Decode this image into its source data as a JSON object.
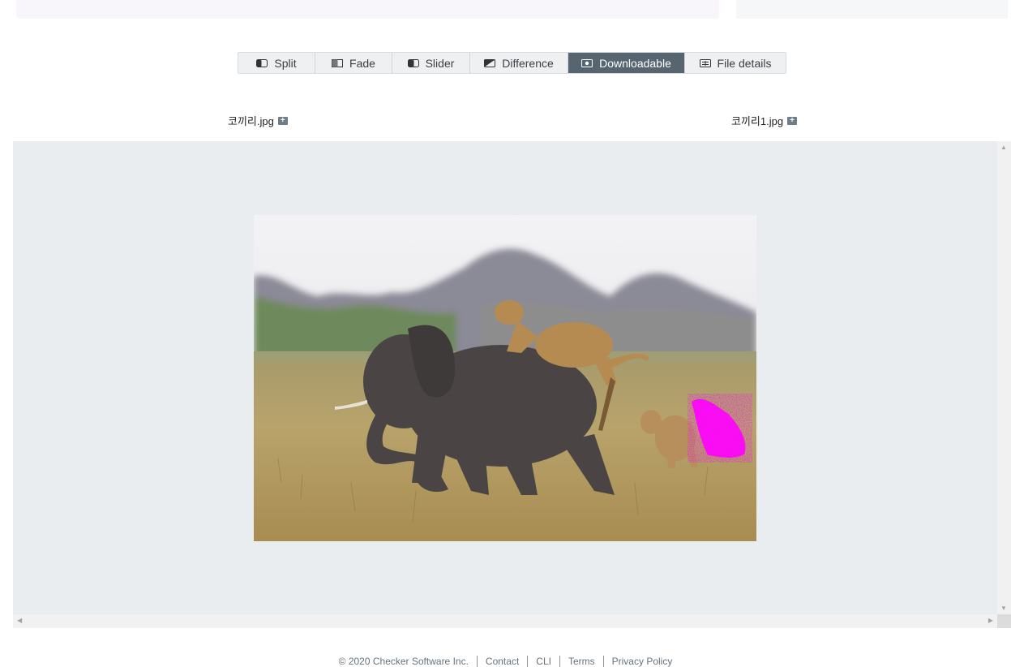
{
  "toolbar": {
    "tabs": [
      {
        "label": "Split",
        "icon": "split-icon"
      },
      {
        "label": "Fade",
        "icon": "fade-icon"
      },
      {
        "label": "Slider",
        "icon": "slider-icon"
      },
      {
        "label": "Difference",
        "icon": "difference-icon"
      },
      {
        "label": "Downloadable",
        "icon": "downloadable-icon",
        "active": true
      },
      {
        "label": "File details",
        "icon": "file-details-icon"
      }
    ]
  },
  "files": {
    "left": {
      "name": "코끼리.jpg"
    },
    "right": {
      "name": "코끼리1.jpg"
    }
  },
  "viewer": {
    "image": "elephant-with-lions-photo",
    "diff_highlight_color": "#ff00ff",
    "background_color": "#eaedf0"
  },
  "colors": {
    "active_tab": "#566570",
    "tab_bg": "#eef0f2"
  },
  "footer": {
    "copyright": "© 2020 Checker Software Inc.",
    "links": [
      "Contact",
      "CLI",
      "Terms",
      "Privacy Policy"
    ]
  }
}
